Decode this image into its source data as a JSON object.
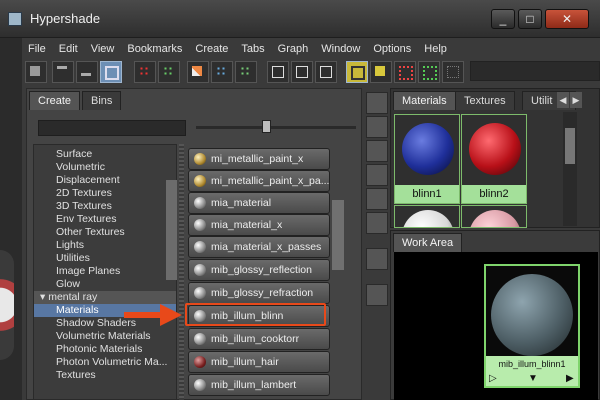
{
  "window": {
    "title": "Hypershade",
    "buttons": [
      "_",
      "□",
      "✕"
    ]
  },
  "menu": [
    "File",
    "Edit",
    "View",
    "Bookmarks",
    "Create",
    "Tabs",
    "Graph",
    "Window",
    "Options",
    "Help"
  ],
  "create_panel": {
    "tabs": [
      "Create",
      "Bins"
    ],
    "tree": [
      "Surface",
      "Volumetric",
      "Displacement",
      "2D Textures",
      "3D Textures",
      "Env Textures",
      "Other Textures",
      "Lights",
      "Utilities",
      "Image Planes",
      "Glow",
      "mental ray",
      "Materials",
      "Shadow Shaders",
      "Volumetric Materials",
      "Photonic Materials",
      "Photon Volumetric Ma...",
      "Textures"
    ],
    "nodes": [
      "mi_metallic_paint_x",
      "mi_metallic_paint_x_pa...",
      "mia_material",
      "mia_material_x",
      "mia_material_x_passes",
      "mib_glossy_reflection",
      "mib_glossy_refraction",
      "mib_illum_blinn",
      "mib_illum_cooktorr",
      "mib_illum_hair",
      "mib_illum_lambert"
    ]
  },
  "materials_panel": {
    "tabs": [
      "Materials",
      "Textures",
      "Utilit"
    ],
    "swatches": [
      {
        "label": "blinn1",
        "color": "#1f2f9a"
      },
      {
        "label": "blinn2",
        "color": "#b81018"
      },
      {
        "label": "",
        "color": "#d8d8d8"
      },
      {
        "label": "",
        "color": "#d89aa4"
      }
    ]
  },
  "work_area": {
    "tab": "Work Area",
    "node_label": "mib_illum_blinn1"
  },
  "colors": {
    "highlight": "#e8491a",
    "selection": "#5877a3",
    "node_border": "#7fd46c"
  }
}
